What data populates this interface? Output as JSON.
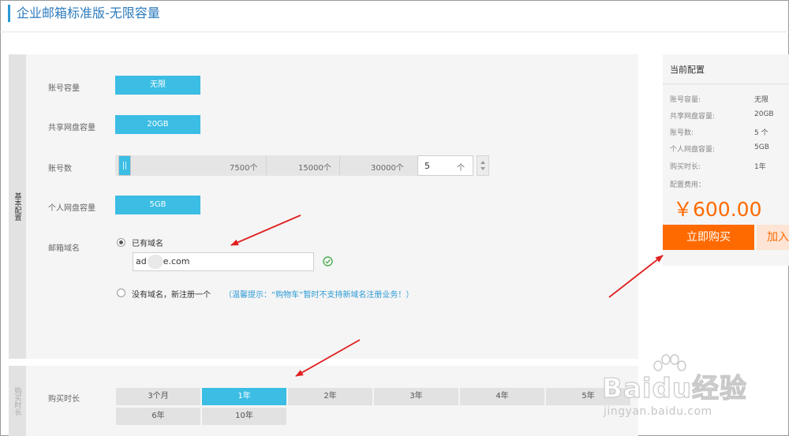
{
  "page": {
    "title": "企业邮箱标准版-无限容量"
  },
  "side_tabs": {
    "basic_config": "基本配置",
    "purchase_duration": "购买时长"
  },
  "config": {
    "account_capacity": {
      "label": "账号容量",
      "value": "无限"
    },
    "shared_disk": {
      "label": "共享网盘容量",
      "value": "20GB"
    },
    "account_count": {
      "label": "账号数",
      "ticks": [
        "7500个",
        "15000个",
        "30000个"
      ],
      "value": "5",
      "unit": "个"
    },
    "personal_disk": {
      "label": "个人网盘容量",
      "value": "5GB"
    },
    "domain": {
      "label": "邮箱域名",
      "option_existing": "已有域名",
      "input_value": "ad      e.com",
      "option_new": "没有域名，新注册一个",
      "hint": "（温馨提示：“购物车”暂时不支持新域名注册业务！）"
    }
  },
  "duration": {
    "label": "购买时长",
    "options": [
      "3个月",
      "1年",
      "2年",
      "3年",
      "4年",
      "5年",
      "6年",
      "10年"
    ],
    "selected": "1年"
  },
  "summary": {
    "title": "当前配置",
    "rows": [
      {
        "label": "账号容量:",
        "value": "无限"
      },
      {
        "label": "共享网盘容量:",
        "value": "20GB"
      },
      {
        "label": "账号数:",
        "value": "5 个"
      },
      {
        "label": "个人网盘容量:",
        "value": "5GB"
      },
      {
        "label": "购买时长:",
        "value": "1年"
      }
    ],
    "fee_label": "配置费用：",
    "price": "￥600.00",
    "buy_label": "立即购买",
    "cart_label": "加入"
  },
  "watermark": {
    "logo_text": "Baidu经验",
    "url": "jingyan.baidu.com"
  },
  "colors": {
    "accent_blue": "#3bbde4",
    "title_blue": "#2e7bbd",
    "orange": "#ff6a00",
    "annotation_red": "#e02020"
  }
}
